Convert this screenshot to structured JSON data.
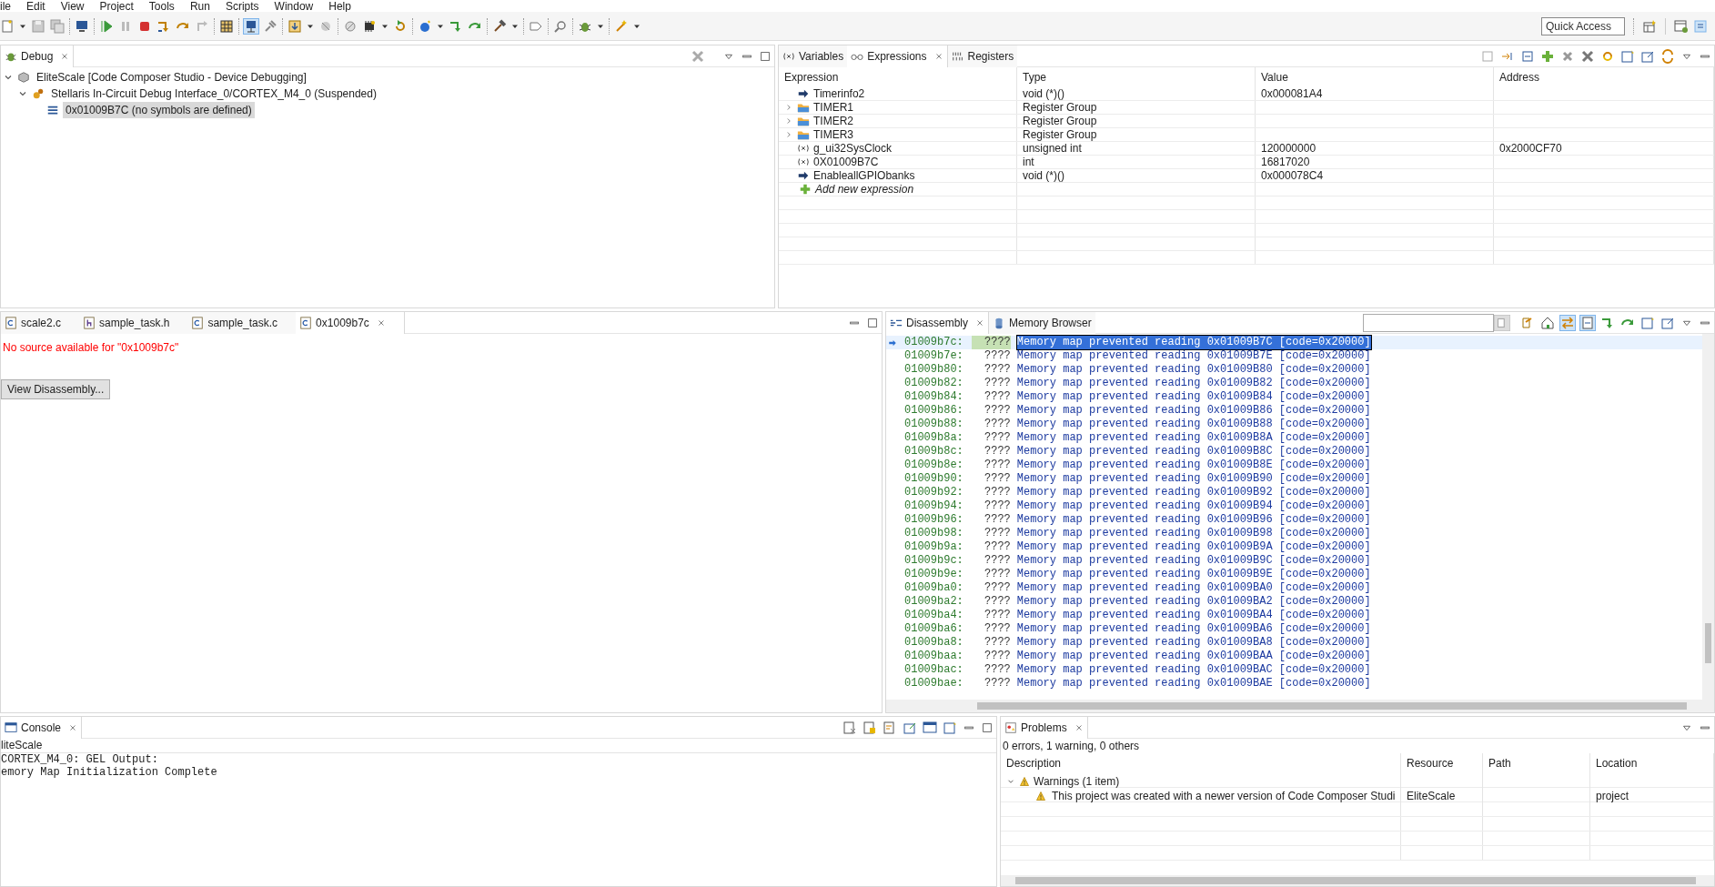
{
  "menu": [
    "ile",
    "Edit",
    "View",
    "Project",
    "Tools",
    "Run",
    "Scripts",
    "Window",
    "Help"
  ],
  "quick_access": {
    "placeholder": "Quick Access"
  },
  "debug_view": {
    "tab": "Debug",
    "tree": [
      {
        "kind": "session",
        "label": "EliteScale [Code Composer Studio - Device Debugging]",
        "expanded": true,
        "selected": false,
        "children": [
          {
            "kind": "core",
            "label": "Stellaris In-Circuit Debug Interface_0/CORTEX_M4_0 (Suspended)",
            "expanded": true,
            "selected": false,
            "children": [
              {
                "kind": "frame",
                "label": "0x01009B7C  (no symbols are defined)",
                "selected": true
              }
            ]
          }
        ]
      }
    ]
  },
  "expressions_view": {
    "tabs": [
      {
        "label": "Variables",
        "selected": false
      },
      {
        "label": "Expressions",
        "selected": true
      },
      {
        "label": "Registers",
        "selected": false
      }
    ],
    "columns": [
      "Expression",
      "Type",
      "Value",
      "Address"
    ],
    "rows": [
      {
        "kind": "function",
        "expression": "Timerinfo2",
        "type": "void (*)()",
        "value": "0x000081A4"
      },
      {
        "kind": "group",
        "expression": "TIMER1",
        "type": "Register Group"
      },
      {
        "kind": "group",
        "expression": "TIMER2",
        "type": "Register Group"
      },
      {
        "kind": "group",
        "expression": "TIMER3",
        "type": "Register Group"
      },
      {
        "kind": "variable",
        "expression": "g_ui32SysClock",
        "type": "unsigned int",
        "value": "120000000",
        "address": "0x2000CF70"
      },
      {
        "kind": "variable",
        "expression": "0X01009B7C",
        "type": "int",
        "value": "16817020"
      },
      {
        "kind": "function",
        "expression": "EnableallGPIObanks",
        "type": "void (*)()",
        "value": "0x000078C4"
      }
    ],
    "add_row": "Add new expression"
  },
  "editor": {
    "tabs": [
      {
        "label": "scale2.c",
        "kind": "c",
        "selected": false
      },
      {
        "label": "sample_task.h",
        "kind": "h",
        "selected": false
      },
      {
        "label": "sample_task.c",
        "kind": "c",
        "selected": false
      },
      {
        "label": "0x1009b7c",
        "kind": "c",
        "selected": true
      }
    ],
    "message": "No source available for \"0x1009b7c\"",
    "button": "View Disassembly..."
  },
  "disassembly_view": {
    "tabs": [
      {
        "label": "Disassembly",
        "selected": true
      },
      {
        "label": "Memory Browser",
        "selected": false
      }
    ],
    "rows": [
      {
        "address": "01009b7c:",
        "opcode": "????",
        "text": "Memory map prevented reading 0x01009B7C [code=0x20000]",
        "selected": true
      },
      {
        "address": "01009b7e:",
        "opcode": "????",
        "text": "Memory map prevented reading 0x01009B7E [code=0x20000]",
        "selected": false
      },
      {
        "address": "01009b80:",
        "opcode": "????",
        "text": "Memory map prevented reading 0x01009B80 [code=0x20000]",
        "selected": false
      },
      {
        "address": "01009b82:",
        "opcode": "????",
        "text": "Memory map prevented reading 0x01009B82 [code=0x20000]",
        "selected": false
      },
      {
        "address": "01009b84:",
        "opcode": "????",
        "text": "Memory map prevented reading 0x01009B84 [code=0x20000]",
        "selected": false
      },
      {
        "address": "01009b86:",
        "opcode": "????",
        "text": "Memory map prevented reading 0x01009B86 [code=0x20000]",
        "selected": false
      },
      {
        "address": "01009b88:",
        "opcode": "????",
        "text": "Memory map prevented reading 0x01009B88 [code=0x20000]",
        "selected": false
      },
      {
        "address": "01009b8a:",
        "opcode": "????",
        "text": "Memory map prevented reading 0x01009B8A [code=0x20000]",
        "selected": false
      },
      {
        "address": "01009b8c:",
        "opcode": "????",
        "text": "Memory map prevented reading 0x01009B8C [code=0x20000]",
        "selected": false
      },
      {
        "address": "01009b8e:",
        "opcode": "????",
        "text": "Memory map prevented reading 0x01009B8E [code=0x20000]",
        "selected": false
      },
      {
        "address": "01009b90:",
        "opcode": "????",
        "text": "Memory map prevented reading 0x01009B90 [code=0x20000]",
        "selected": false
      },
      {
        "address": "01009b92:",
        "opcode": "????",
        "text": "Memory map prevented reading 0x01009B92 [code=0x20000]",
        "selected": false
      },
      {
        "address": "01009b94:",
        "opcode": "????",
        "text": "Memory map prevented reading 0x01009B94 [code=0x20000]",
        "selected": false
      },
      {
        "address": "01009b96:",
        "opcode": "????",
        "text": "Memory map prevented reading 0x01009B96 [code=0x20000]",
        "selected": false
      },
      {
        "address": "01009b98:",
        "opcode": "????",
        "text": "Memory map prevented reading 0x01009B98 [code=0x20000]",
        "selected": false
      },
      {
        "address": "01009b9a:",
        "opcode": "????",
        "text": "Memory map prevented reading 0x01009B9A [code=0x20000]",
        "selected": false
      },
      {
        "address": "01009b9c:",
        "opcode": "????",
        "text": "Memory map prevented reading 0x01009B9C [code=0x20000]",
        "selected": false
      },
      {
        "address": "01009b9e:",
        "opcode": "????",
        "text": "Memory map prevented reading 0x01009B9E [code=0x20000]",
        "selected": false
      },
      {
        "address": "01009ba0:",
        "opcode": "????",
        "text": "Memory map prevented reading 0x01009BA0 [code=0x20000]",
        "selected": false
      },
      {
        "address": "01009ba2:",
        "opcode": "????",
        "text": "Memory map prevented reading 0x01009BA2 [code=0x20000]",
        "selected": false
      },
      {
        "address": "01009ba4:",
        "opcode": "????",
        "text": "Memory map prevented reading 0x01009BA4 [code=0x20000]",
        "selected": false
      },
      {
        "address": "01009ba6:",
        "opcode": "????",
        "text": "Memory map prevented reading 0x01009BA6 [code=0x20000]",
        "selected": false
      },
      {
        "address": "01009ba8:",
        "opcode": "????",
        "text": "Memory map prevented reading 0x01009BA8 [code=0x20000]",
        "selected": false
      },
      {
        "address": "01009baa:",
        "opcode": "????",
        "text": "Memory map prevented reading 0x01009BAA [code=0x20000]",
        "selected": false
      },
      {
        "address": "01009bac:",
        "opcode": "????",
        "text": "Memory map prevented reading 0x01009BAC [code=0x20000]",
        "selected": false
      },
      {
        "address": "01009bae:",
        "opcode": "????",
        "text": "Memory map prevented reading 0x01009BAE [code=0x20000]",
        "selected": false
      }
    ]
  },
  "console": {
    "tab": "Console",
    "header": "liteScale",
    "lines": [
      "CORTEX_M4_0: GEL Output:",
      "emory Map Initialization Complete"
    ]
  },
  "problems": {
    "tab": "Problems",
    "summary": "0 errors, 1 warning, 0 others",
    "columns": [
      "Description",
      "Resource",
      "Path",
      "Location"
    ],
    "groups": [
      {
        "label": "Warnings (1 item)",
        "expanded": true,
        "children": [
          {
            "description": "This project was created with a newer version of Code Composer Studi",
            "resource": "EliteScale",
            "location": "project"
          }
        ]
      }
    ]
  }
}
